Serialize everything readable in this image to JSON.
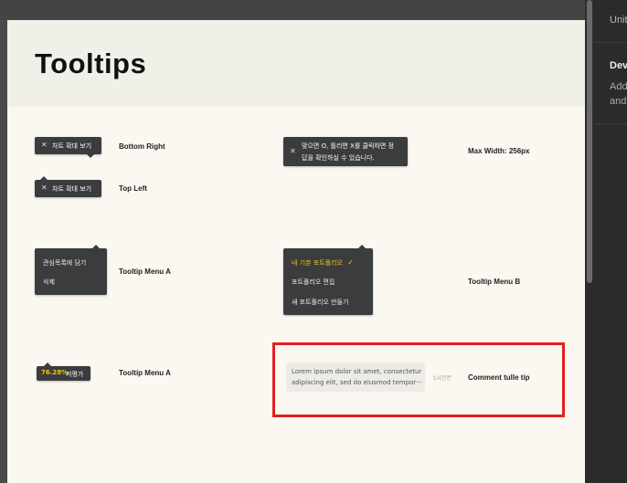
{
  "page": {
    "title": "Tooltips"
  },
  "right_panel": {
    "unit_label": "Unit",
    "dev_heading": "Dev",
    "desc_line1": "Add",
    "desc_line2": "and"
  },
  "tooltips": {
    "bottom_right": {
      "close": "✕",
      "text": "차트 확대 보기",
      "label": "Bottom Right"
    },
    "top_left": {
      "close": "✕",
      "text": "차트 확대 보기",
      "label": "Top Left"
    },
    "max_width": {
      "close": "✕",
      "line1": "맞으면 O, 틀리면 X를 클릭하면 정",
      "line2": "답을 확인하실 수 있습니다.",
      "label": "Max Width: 256px"
    },
    "menu_a": {
      "items": [
        "관심목록에 담기",
        "삭제"
      ],
      "label": "Tooltip Menu A"
    },
    "menu_b": {
      "items": [
        "내 기본 포트폴리오",
        "포트폴리오 편집",
        "새 포트폴리오 만들기"
      ],
      "check": "✓",
      "label": "Tooltip Menu B"
    },
    "valuation": {
      "value": "76.28%",
      "suffix": " 저평가",
      "label": "Tooltip Menu A"
    },
    "comment": {
      "line1": "Lorem ipsum dolor sit amet, consectetur",
      "line2": "adipiscing elit, sed do eiusmod tempor···",
      "time": "1시간전",
      "label": "Comment tulle tip"
    }
  },
  "colors": {
    "tooltip_bg": "#3a3c3e",
    "accent_yellow": "#f5c518",
    "highlight_red": "#e02020",
    "page_bg": "#fbf8f1",
    "header_bg": "#f1f0e8"
  }
}
